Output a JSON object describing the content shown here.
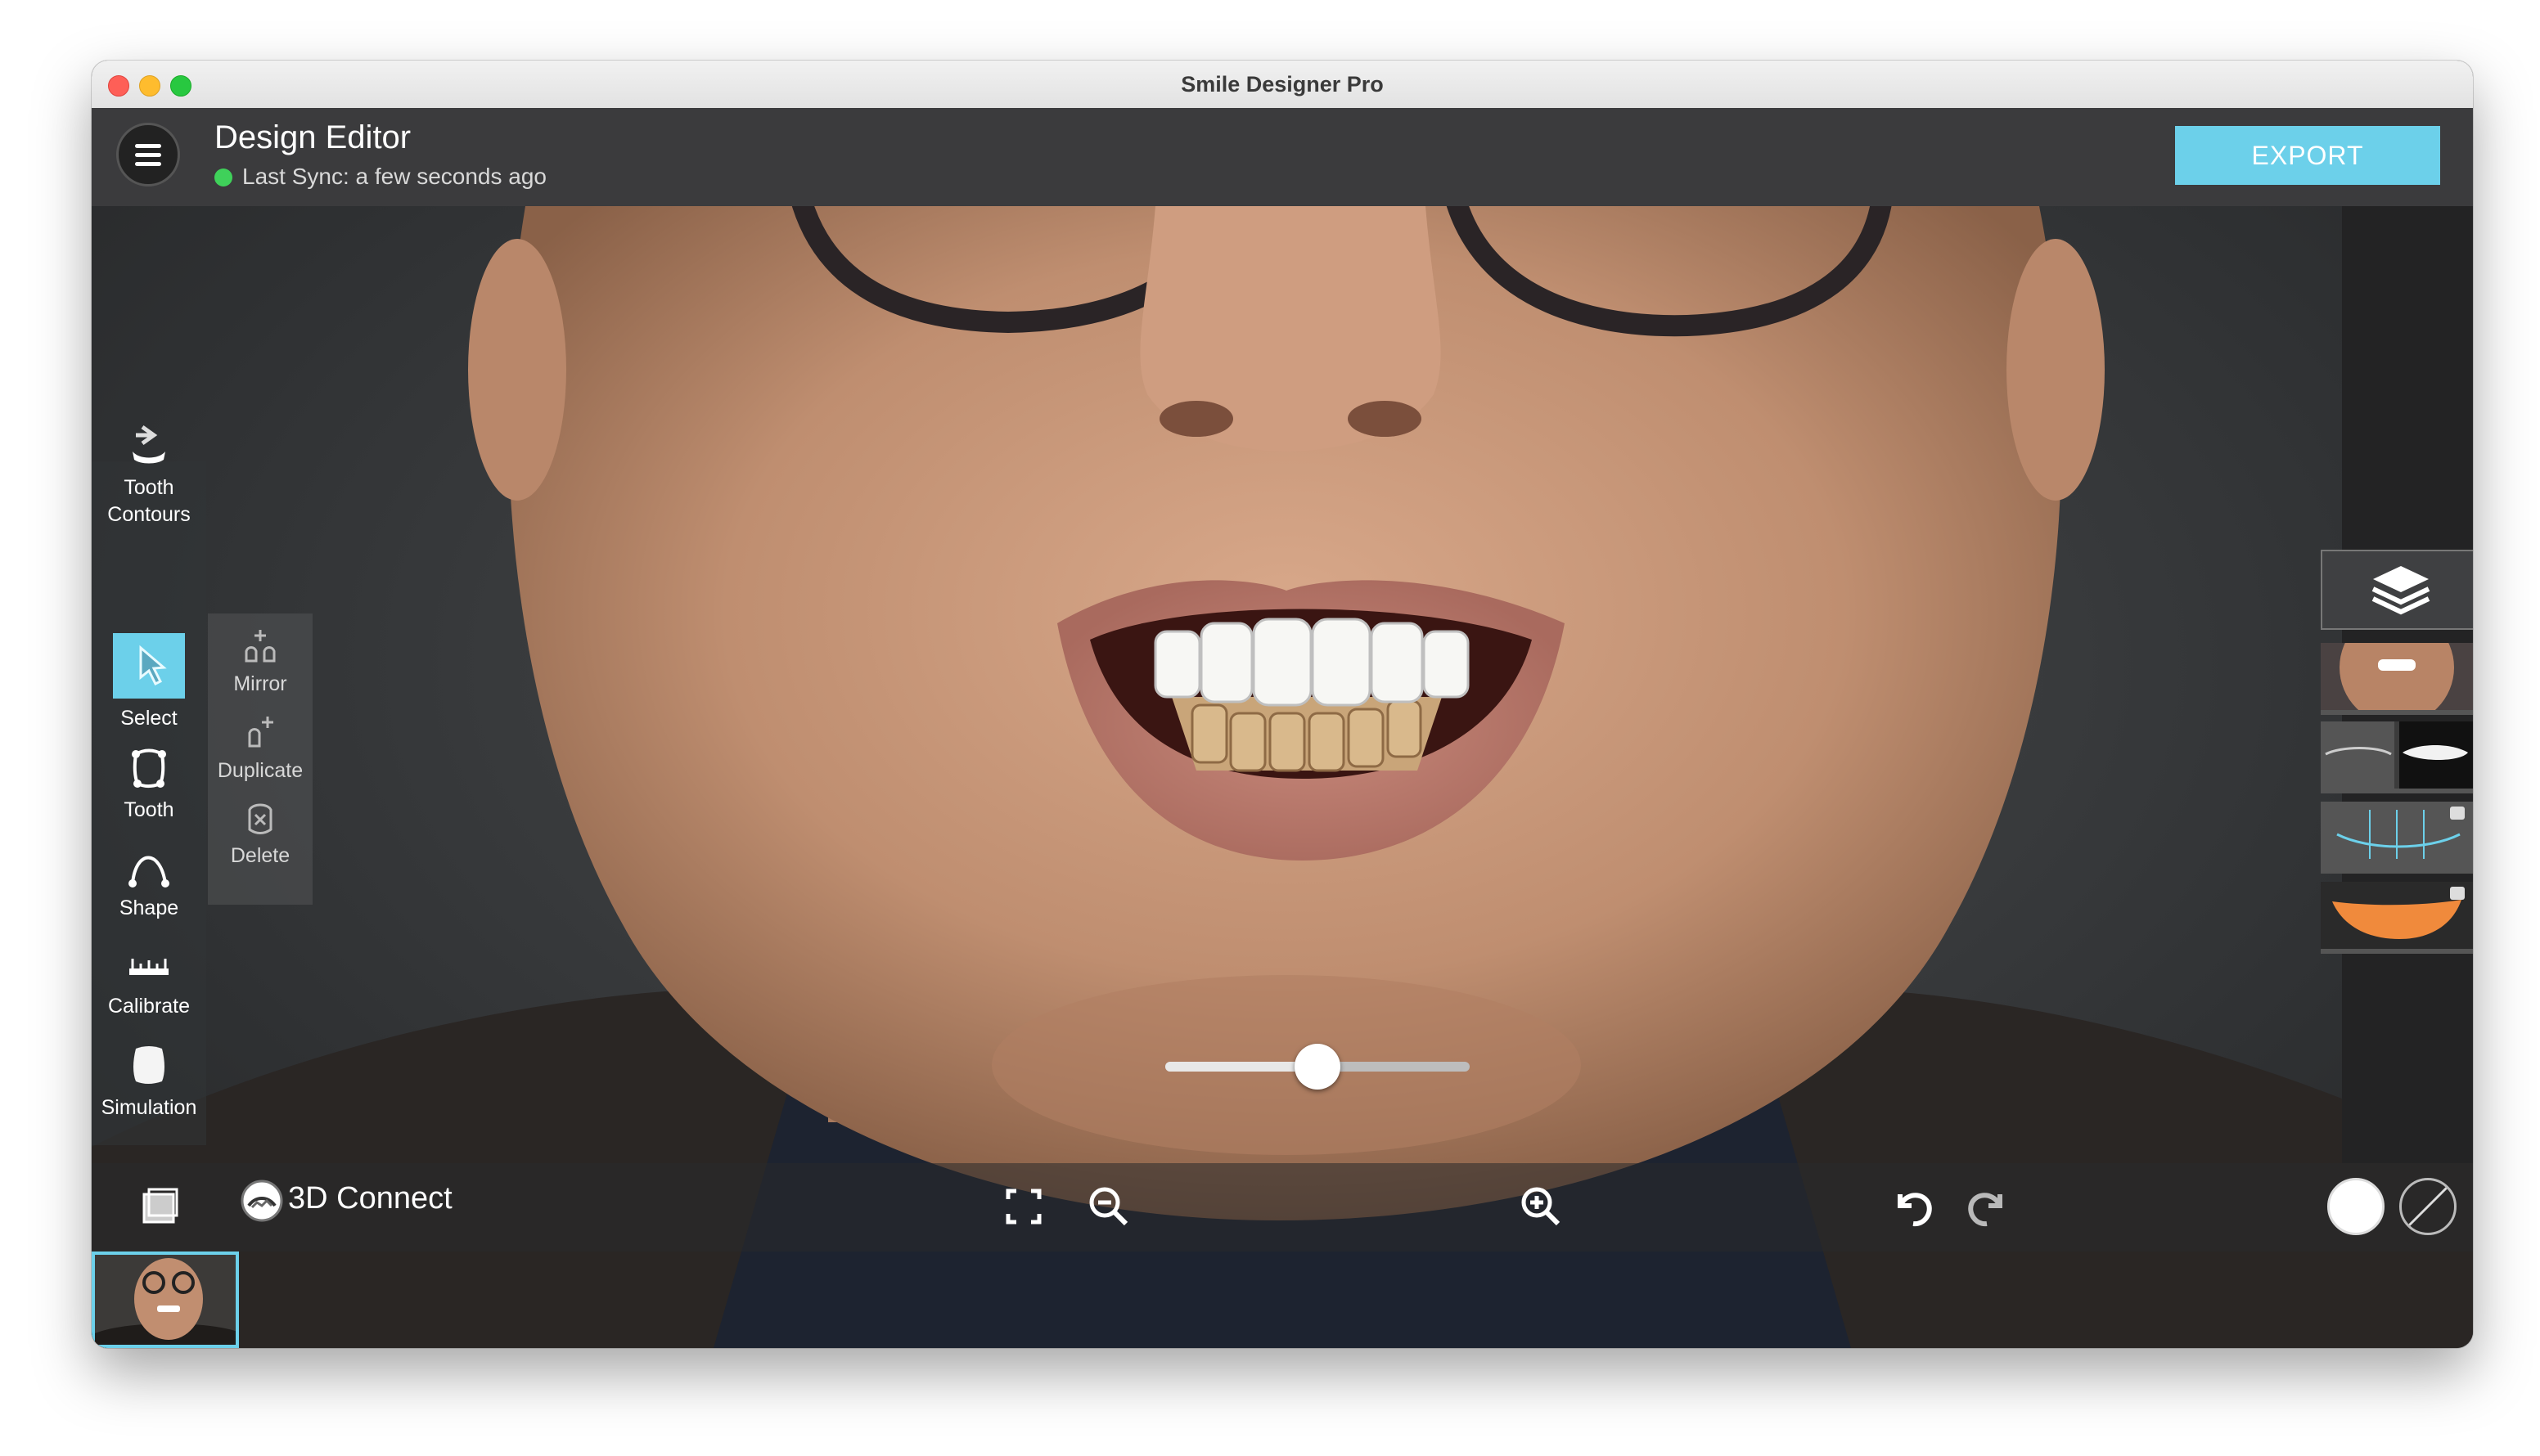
{
  "window": {
    "title": "Smile Designer Pro"
  },
  "header": {
    "title": "Design Editor",
    "sync_status": "Last Sync: a few seconds ago",
    "export_label": "EXPORT"
  },
  "tools": [
    {
      "label_line1": "Tooth",
      "label_line2": "Contours",
      "icon": "tooth-contours-icon"
    },
    {
      "label": "Select",
      "icon": "select-cursor-icon",
      "active": true
    },
    {
      "label": "Tooth",
      "icon": "tooth-outline-icon"
    },
    {
      "label": "Shape",
      "icon": "shape-curve-icon"
    },
    {
      "label": "Calibrate",
      "icon": "ruler-icon"
    },
    {
      "label": "Simulation",
      "icon": "simulation-tooth-icon"
    }
  ],
  "subtools": [
    {
      "label": "Mirror",
      "icon": "mirror-icon"
    },
    {
      "label": "Duplicate",
      "icon": "duplicate-icon"
    },
    {
      "label": "Delete",
      "icon": "delete-icon"
    }
  ],
  "bottom": {
    "connect_label": "3D Connect",
    "zoom_fraction": 0.5
  },
  "colors": {
    "accent": "#6cd0ea",
    "header_bg": "#3b3b3d",
    "sync_dot": "#3fd15a",
    "gum_layer": "#f08a3c"
  },
  "layers": [
    {
      "name": "photo-layer-thumbnail"
    },
    {
      "name": "teeth-library-layer-thumbnail"
    },
    {
      "name": "grid-layer-thumbnail",
      "locked": true
    },
    {
      "name": "gum-layer-thumbnail",
      "locked": true
    }
  ]
}
